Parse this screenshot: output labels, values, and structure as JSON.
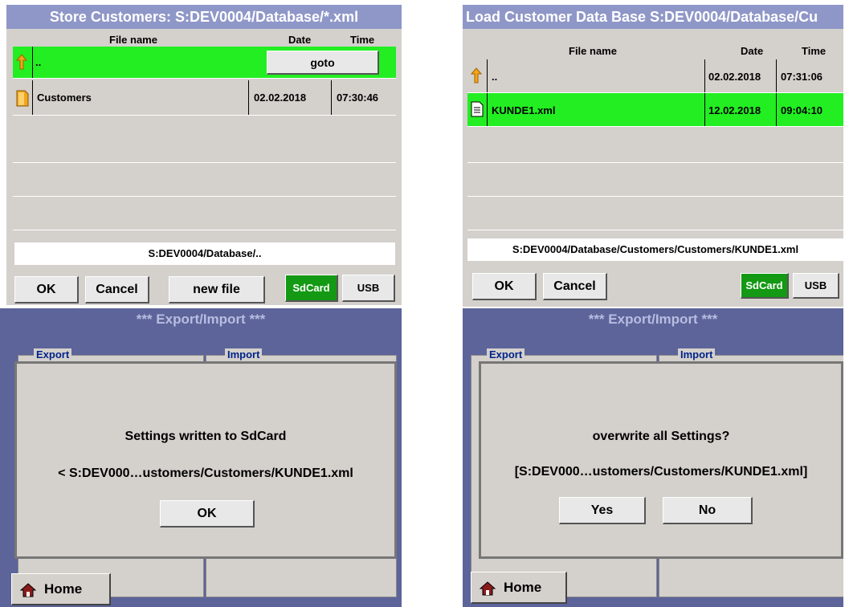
{
  "store": {
    "title": "Store Customers:  S:DEV0004/Database/*.xml",
    "col_file": "File name",
    "col_date": "Date",
    "col_time": "Time",
    "row_up_name": "..",
    "goto_label": "goto",
    "row_folder_name": "Customers",
    "row_folder_date": "02.02.2018",
    "row_folder_time": "07:30:46",
    "path": "S:DEV0004/Database/..",
    "ok": "OK",
    "cancel": "Cancel",
    "new_file": "new file",
    "sdcard": "SdCard",
    "usb": "USB"
  },
  "load": {
    "title": "Load Customer Data Base S:DEV0004/Database/Cu",
    "col_file": "File name",
    "col_date": "Date",
    "col_time": "Time",
    "row_up_name": "..",
    "row_up_date": "02.02.2018",
    "row_up_time": "07:31:06",
    "row_file_name": "KUNDE1.xml",
    "row_file_date": "12.02.2018",
    "row_file_time": "09:04:10",
    "path": "S:DEV0004/Database/Customers/Customers/KUNDE1.xml",
    "ok": "OK",
    "cancel": "Cancel",
    "sdcard": "SdCard",
    "usb": "USB"
  },
  "export_left": {
    "title": "***  Export/Import  ***",
    "export_group": "Export",
    "import_group": "Import",
    "dialog_line1": "Settings written to SdCard",
    "dialog_line2": "< S:DEV000…ustomers/Customers/KUNDE1.xml",
    "ok": "OK",
    "home": "Home"
  },
  "export_right": {
    "title": "***  Export/Import  ***",
    "export_group": "Export",
    "import_group": "Import",
    "dialog_line1": "overwrite all Settings?",
    "dialog_line2": "[S:DEV000…ustomers/Customers/KUNDE1.xml]",
    "yes": "Yes",
    "no": "No",
    "home": "Home"
  },
  "colors": {
    "title_bar": "#8f97c8",
    "selected_row": "#22ee22",
    "sdcard_active": "#139913",
    "lower_background": "#5c649a",
    "group_label": "#00248a"
  },
  "icons": [
    "up-arrow-icon",
    "folder-icon",
    "xml-file-icon",
    "home-icon"
  ]
}
